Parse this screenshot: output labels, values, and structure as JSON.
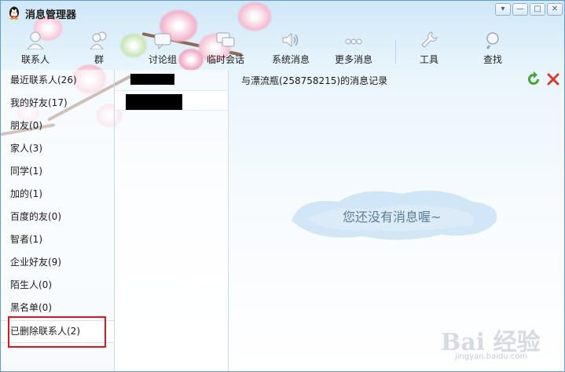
{
  "window": {
    "title": "消息管理器",
    "controls": {
      "tools": "▾",
      "minimize": "—",
      "maximize": "□",
      "close": "✕"
    }
  },
  "toolbar": {
    "items": [
      {
        "label": "联系人",
        "icon": "contact-icon"
      },
      {
        "label": "群",
        "icon": "group-icon"
      },
      {
        "label": "讨论组",
        "icon": "discussion-icon"
      },
      {
        "label": "临时会话",
        "icon": "temp-chat-icon"
      },
      {
        "label": "系统消息",
        "icon": "speaker-icon"
      },
      {
        "label": "更多消息",
        "icon": "more-dots-icon"
      },
      {
        "label": "工具",
        "icon": "wrench-icon"
      },
      {
        "label": "查找",
        "icon": "magnifier-icon"
      }
    ]
  },
  "groups": {
    "items": [
      {
        "label": "最近联系人(26)"
      },
      {
        "label": "我的好友(17)"
      },
      {
        "label": "朋友(0)"
      },
      {
        "label": "家人(3)"
      },
      {
        "label": "同学(1)"
      },
      {
        "label": "加的(1)"
      },
      {
        "label": "百度的友(0)"
      },
      {
        "label": "智者(1)"
      },
      {
        "label": "企业好友(9)"
      },
      {
        "label": "陌生人(0)"
      },
      {
        "label": "黑名单(0)"
      },
      {
        "label": "已删除联系人(2)"
      }
    ],
    "selected_index": 11
  },
  "record": {
    "title": "与漂流瓶(258758215)的消息记录",
    "empty_text": "您还没有消息喔~"
  },
  "watermark": {
    "main": "Bai 经验",
    "sub": "jingyan.baidu.com"
  },
  "colors": {
    "accent_blue": "#3f8fd0",
    "highlight_red": "#e1141c",
    "refresh_green": "#3fa63a",
    "delete_red": "#d33b2b"
  }
}
